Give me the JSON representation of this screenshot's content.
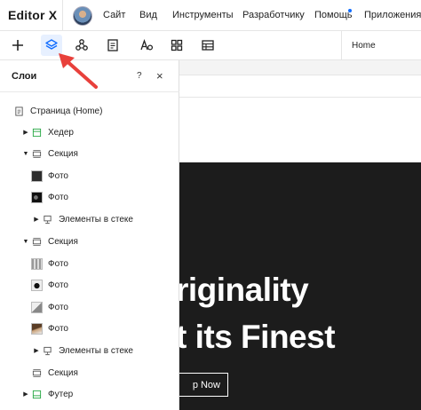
{
  "app": {
    "logo": "Editor X"
  },
  "topbar": {
    "menu": [
      {
        "label": "Сайт"
      },
      {
        "label": "Вид"
      },
      {
        "label": "Инструменты"
      },
      {
        "label": "Разработчику"
      },
      {
        "label": "Помощь"
      },
      {
        "label": "Приложения"
      }
    ]
  },
  "toolbar": {
    "tools": [
      "add-icon",
      "layers-icon",
      "components-icon",
      "pages-icon",
      "typography-icon",
      "apps-icon",
      "table-icon"
    ],
    "current_page": "Home",
    "active_color": "#116dff"
  },
  "layers_panel": {
    "title": "Слои",
    "help": "?",
    "close": "×",
    "items": [
      {
        "label": "Страница (Home)"
      },
      {
        "label": "Хедер"
      },
      {
        "label": "Секция"
      },
      {
        "label": "Фото"
      },
      {
        "label": "Фото"
      },
      {
        "label": "Элементы в стеке"
      },
      {
        "label": "Секция"
      },
      {
        "label": "Фото"
      },
      {
        "label": "Фото"
      },
      {
        "label": "Фото"
      },
      {
        "label": "Фото"
      },
      {
        "label": "Элементы в стеке"
      },
      {
        "label": "Секция"
      },
      {
        "label": "Футер"
      }
    ]
  },
  "canvas": {
    "hero_line1": "riginality",
    "hero_line2": "t its Finest",
    "cta": "p Now"
  }
}
